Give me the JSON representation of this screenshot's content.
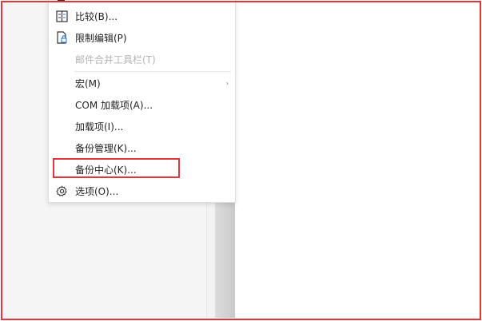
{
  "menu": {
    "items": [
      {
        "label": "比较(B)...",
        "icon": "compare-icon"
      },
      {
        "label": "限制编辑(P)",
        "icon": "restrict-editing-icon"
      },
      {
        "label": "邮件合并工具栏(T)"
      },
      {
        "label": "宏(M)",
        "submenu_arrow": "›"
      },
      {
        "label": "COM 加载项(A)..."
      },
      {
        "label": "加载项(I)..."
      },
      {
        "label": "备份管理(K)..."
      },
      {
        "label": "备份中心(K)..."
      },
      {
        "label": "选项(O)...",
        "icon": "gear-icon"
      }
    ]
  },
  "colors": {
    "highlight": "#e0373e",
    "menu_text": "#222222",
    "disabled_text": "#b3b3b3"
  }
}
